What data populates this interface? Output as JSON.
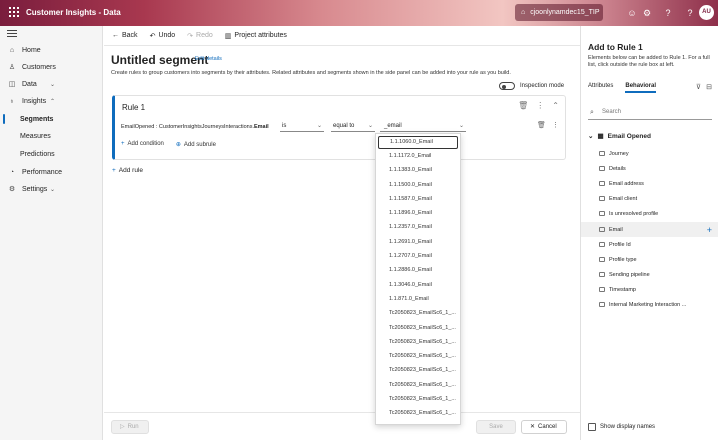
{
  "topbar": {
    "app_title": "Customer Insights - Data",
    "environment": "cjoonlynamdec15_TIP",
    "avatar_initials": "AU"
  },
  "nav": {
    "items": [
      {
        "label": "Home",
        "icon": "home-icon"
      },
      {
        "label": "Customers",
        "icon": "person-icon"
      },
      {
        "label": "Data",
        "icon": "database-icon"
      },
      {
        "label": "Insights",
        "icon": "lightbulb-icon"
      },
      {
        "label": "Segments",
        "sub": true,
        "active": true
      },
      {
        "label": "Measures",
        "sub": true
      },
      {
        "label": "Predictions",
        "sub": true
      },
      {
        "label": "Performance",
        "icon": "gauge-icon"
      },
      {
        "label": "Settings",
        "icon": "gear-icon"
      }
    ]
  },
  "cmdbar": {
    "back": "Back",
    "undo": "Undo",
    "redo": "Redo",
    "project": "Project attributes"
  },
  "segment": {
    "title": "Untitled segment",
    "edit_link": "Edit details",
    "description": "Create rules to group customers into segments by their attributes. Related attributes and segments shown in the side panel can be added into your rule as you build.",
    "inspection_mode": "Inspection mode",
    "rule_title": "Rule 1",
    "condition_prefix": "EmailOpened : CustomerInsightsJourneysInteractions.",
    "condition_attr": "Email",
    "operator1": "is",
    "operator2": "equal to",
    "value": "_email",
    "add_condition": "Add condition",
    "add_subrule": "Add subrule",
    "add_rule": "Add rule"
  },
  "dropdown": {
    "options": [
      "1.1.1060.0_Email",
      "1.1.1172.0_Email",
      "1.1.1383.0_Email",
      "1.1.1500.0_Email",
      "1.1.1587.0_Email",
      "1.1.1896.0_Email",
      "1.1.2357.0_Email",
      "1.1.2691.0_Email",
      "1.1.2707.0_Email",
      "1.1.2886.0_Email",
      "1.1.3046.0_Email",
      "1.1.871.0_Email",
      "Tc2050823_EmailSc6_1_...",
      "Tc2050823_EmailSc6_1_...",
      "Tc2050823_EmailSc6_1_...",
      "Tc2050823_EmailSc6_1_...",
      "Tc2050823_EmailSc6_1_...",
      "Tc2050823_EmailSc6_1_...",
      "Tc2050823_EmailSc6_1_...",
      "Tc2050823_EmailSc6_1_..."
    ]
  },
  "footer": {
    "run": "Run",
    "save": "Save",
    "cancel": "Cancel"
  },
  "rpanel": {
    "title": "Add to Rule 1",
    "description": "Elements below can be added to Rule 1. For a full list, click outside the rule box at left.",
    "tab_attributes": "Attributes",
    "tab_behavioral": "Behavioral",
    "search_placeholder": "Search",
    "group": "Email Opened",
    "items": [
      "Journey",
      "Details",
      "Email address",
      "Email client",
      "Is unresolved profile",
      "Email",
      "Profile Id",
      "Profile type",
      "Sending pipeline",
      "Timestamp",
      "Internal Marketing Interaction ..."
    ],
    "show_display_names": "Show display names"
  },
  "colors": {
    "accent": "#0f6cbd",
    "topbar_start": "#7a1d3d"
  }
}
